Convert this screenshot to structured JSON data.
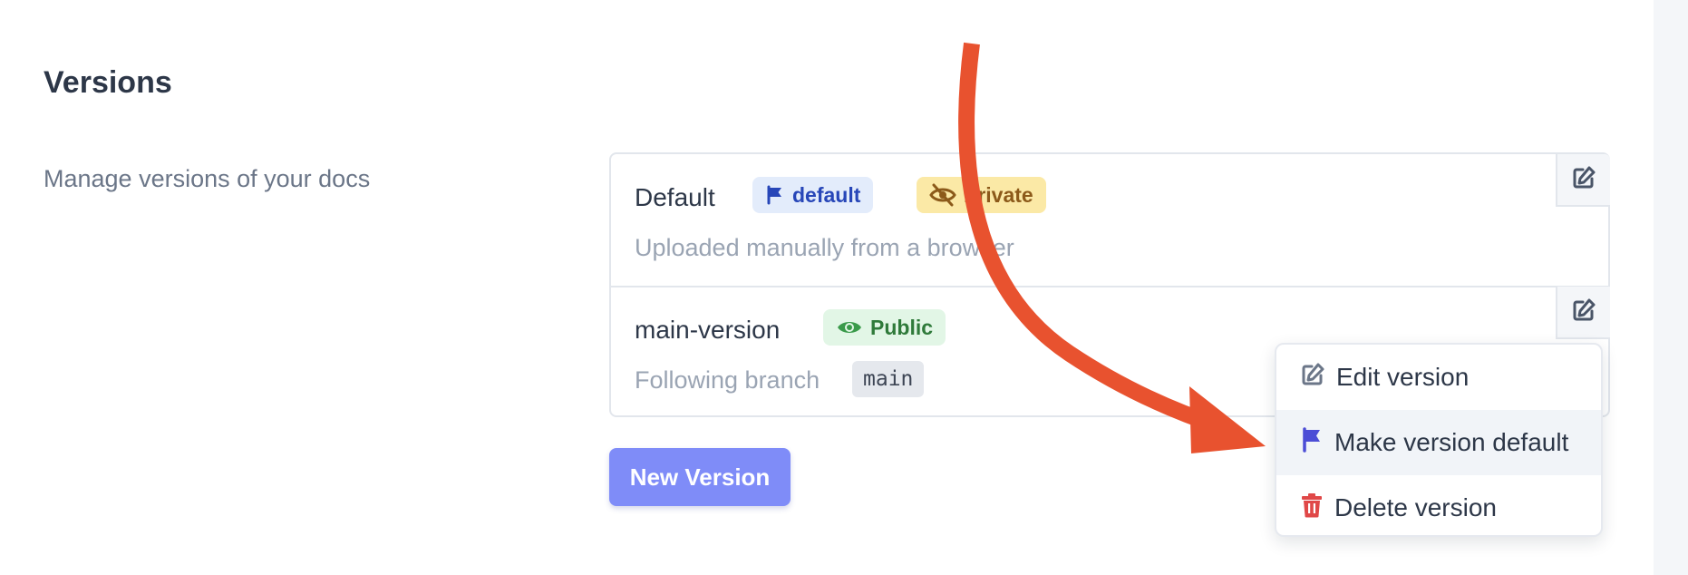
{
  "page": {
    "title": "Versions",
    "description": "Manage versions of your docs"
  },
  "versions": [
    {
      "name": "Default",
      "badges": [
        {
          "label": "default",
          "icon": "flag-icon"
        },
        {
          "label": "Private",
          "icon": "eye-slash-icon"
        }
      ],
      "subtitle": "Uploaded manually from a browser"
    },
    {
      "name": "main-version",
      "badges": [
        {
          "label": "Public",
          "icon": "eye-icon"
        }
      ],
      "subtitle": "Following branch",
      "branch": "main"
    }
  ],
  "actions": {
    "new_version_label": "New Version"
  },
  "menu": {
    "items": [
      {
        "label": "Edit version",
        "icon": "edit-icon"
      },
      {
        "label": "Make version default",
        "icon": "flag-icon"
      },
      {
        "label": "Delete version",
        "icon": "trash-icon"
      }
    ]
  },
  "colors": {
    "accent": "#7f8cf8",
    "annotation_arrow": "#e8522f",
    "default_badge": "#e3ecfb",
    "private_badge": "#fbe9a6",
    "public_badge": "#e2f6e6",
    "delete": "#e04848",
    "make_default_flag": "#4c4dd6"
  }
}
